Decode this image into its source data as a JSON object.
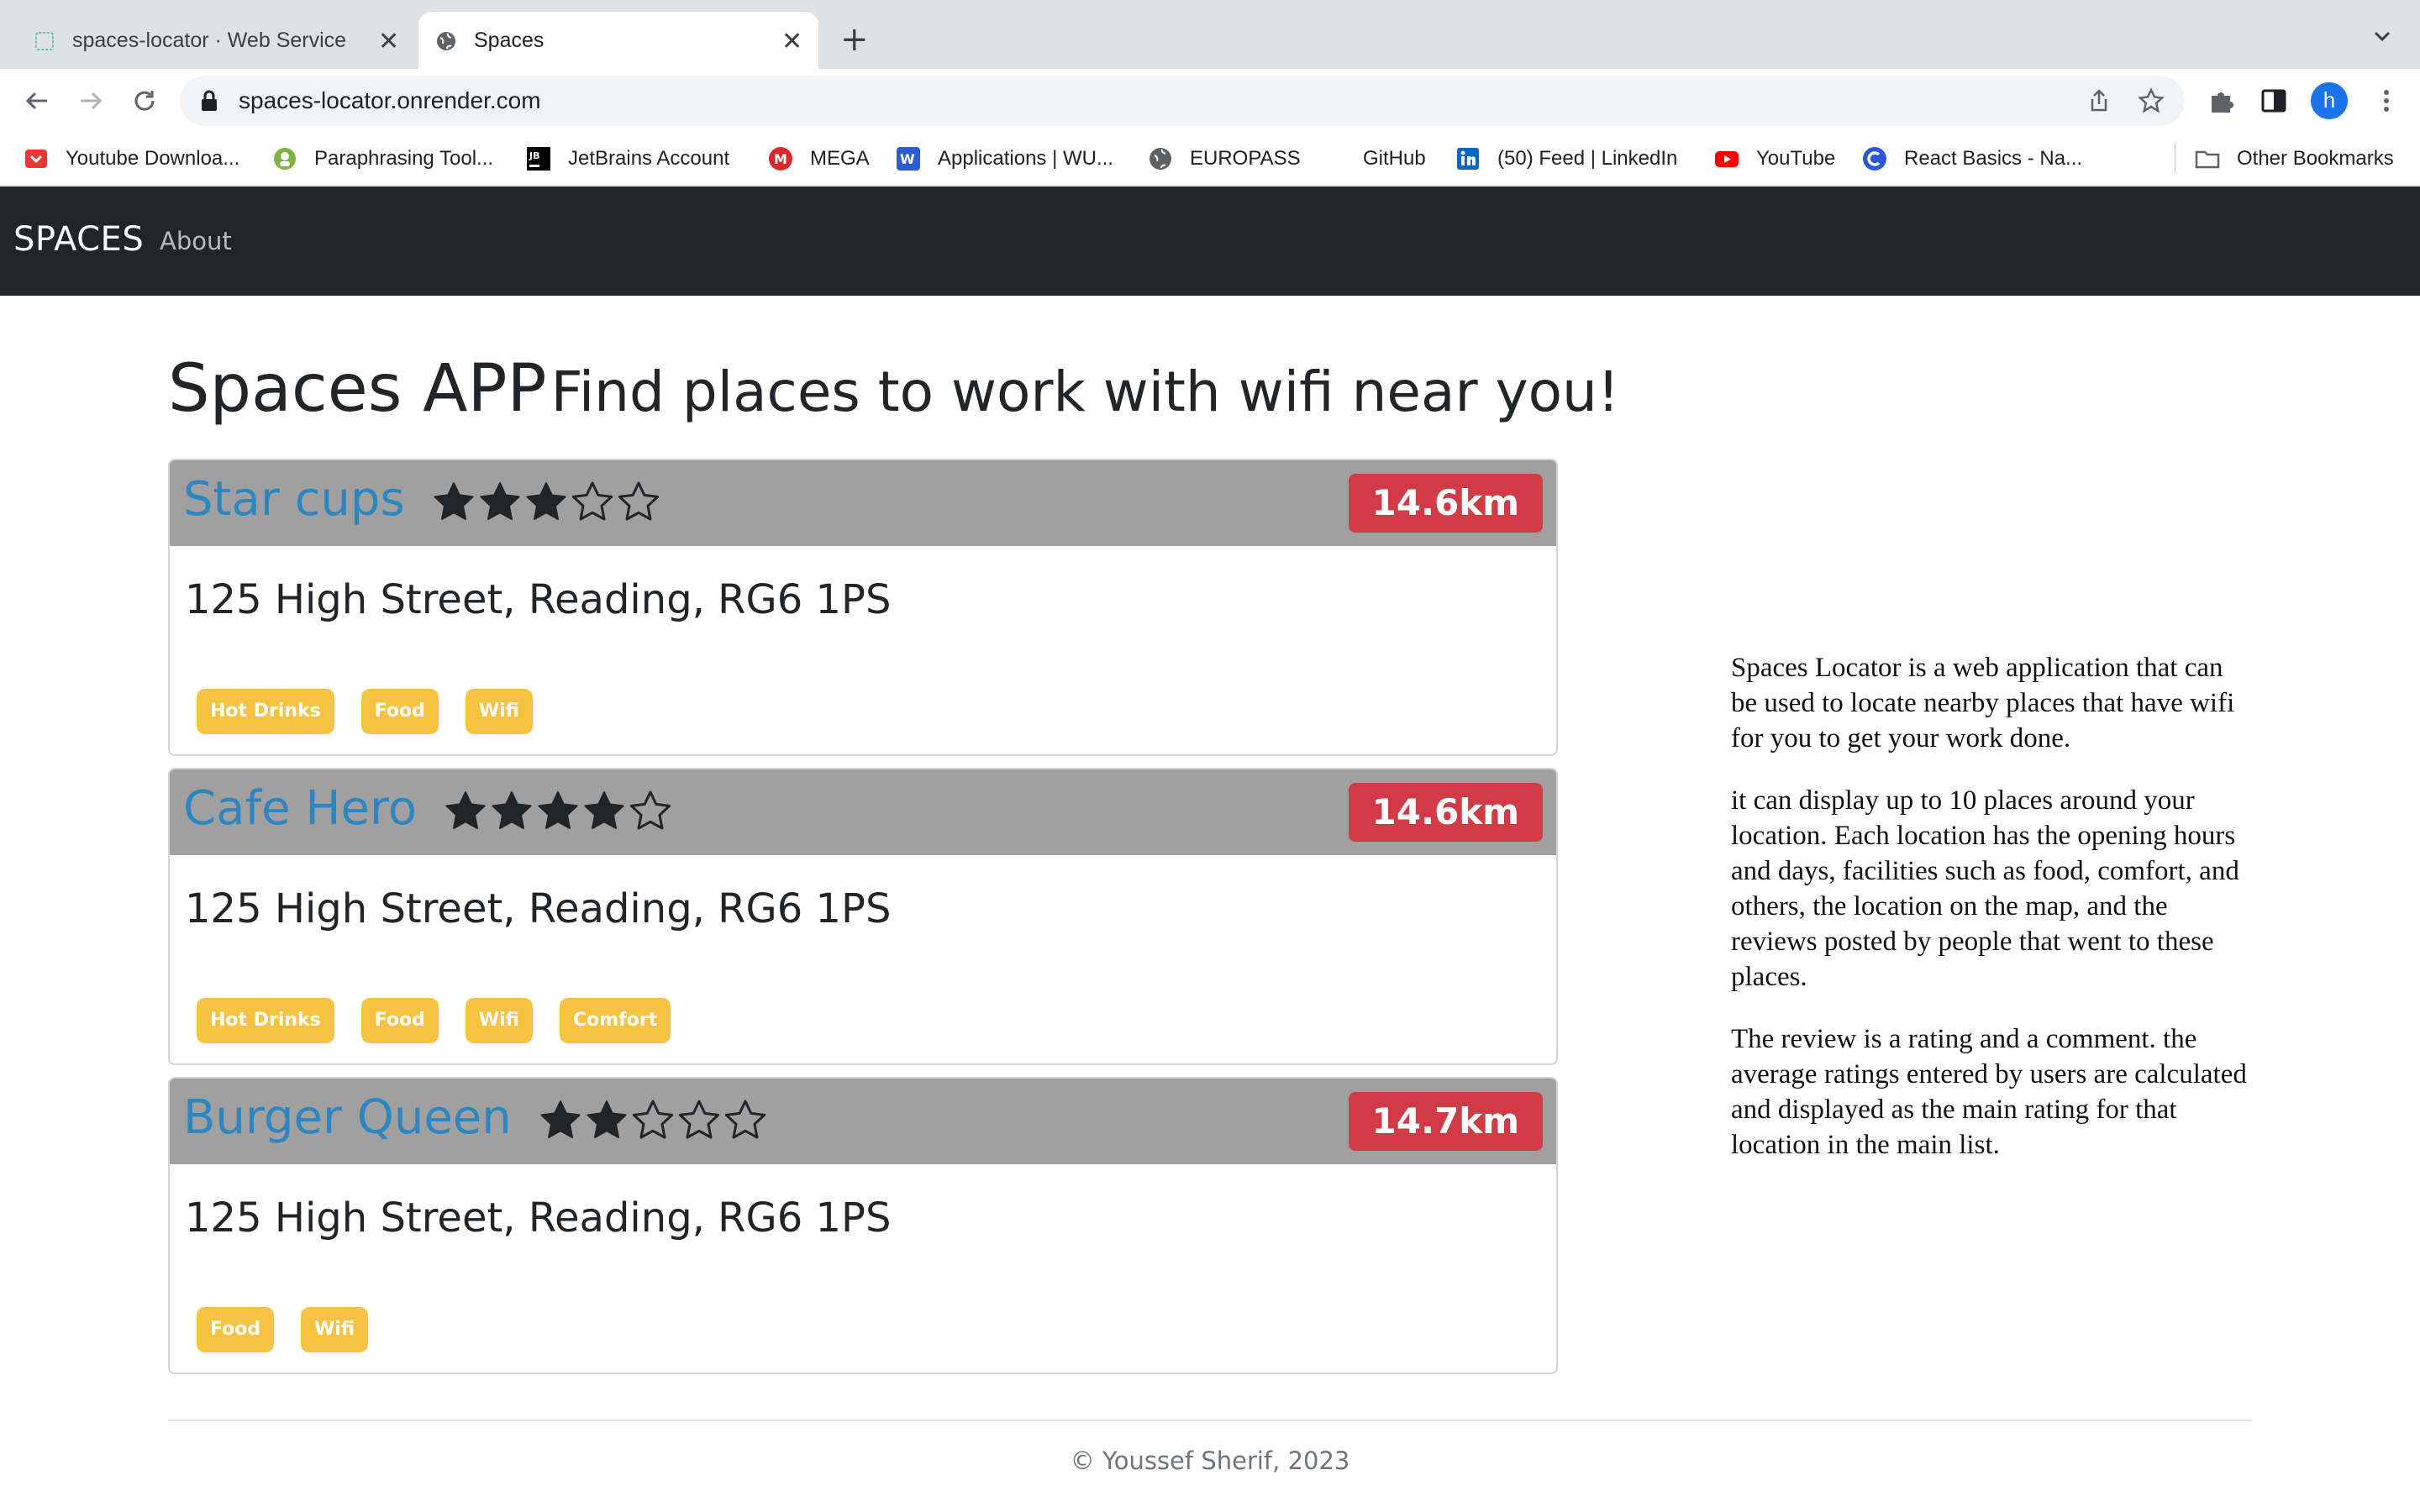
{
  "browser": {
    "tabs": [
      {
        "title": "spaces-locator · Web Service",
        "active": false
      },
      {
        "title": "Spaces",
        "active": true
      }
    ],
    "url": "spaces-locator.onrender.com",
    "profile_initial": "h",
    "bookmarks": [
      {
        "label": "Youtube Downloa...",
        "icon": "youtube-download-icon"
      },
      {
        "label": "Paraphrasing Tool...",
        "icon": "paraphrase-icon"
      },
      {
        "label": "JetBrains Account",
        "icon": "jetbrains-icon"
      },
      {
        "label": "MEGA",
        "icon": "mega-icon"
      },
      {
        "label": "Applications | WU...",
        "icon": "wu-icon"
      },
      {
        "label": "EUROPASS",
        "icon": "globe-icon"
      },
      {
        "label": "GitHub",
        "icon": "github-icon"
      },
      {
        "label": "(50) Feed | LinkedIn",
        "icon": "linkedin-icon"
      },
      {
        "label": "YouTube",
        "icon": "youtube-icon"
      },
      {
        "label": "React Basics - Na...",
        "icon": "coursera-icon"
      }
    ],
    "other_bookmarks": "Other Bookmarks"
  },
  "site": {
    "brand": "SPACES",
    "nav_about": "About",
    "heading_main": "Spaces APP",
    "heading_sub": "Find places to work with wifi near you!",
    "locations": [
      {
        "name": "Star cups",
        "rating": 3,
        "distance": "14.6km",
        "address": "125 High Street, Reading, RG6 1PS",
        "facilities": [
          "Hot Drinks",
          "Food",
          "Wifi"
        ]
      },
      {
        "name": "Cafe Hero",
        "rating": 4,
        "distance": "14.6km",
        "address": "125 High Street, Reading, RG6 1PS",
        "facilities": [
          "Hot Drinks",
          "Food",
          "Wifi",
          "Comfort"
        ]
      },
      {
        "name": "Burger Queen",
        "rating": 2,
        "distance": "14.7km",
        "address": "125 High Street, Reading, RG6 1PS",
        "facilities": [
          "Food",
          "Wifi"
        ]
      }
    ],
    "about_paragraphs": [
      "Spaces Locator is a web application that can be used to locate nearby places that have wifi for you to get your work done.",
      "it can display up to 10 places around your location. Each location has the opening hours and days, facilities such as food, comfort, and others, the location on the map, and the reviews posted by people that went to these places.",
      "The review is a rating and a comment. the average ratings entered by users are calculated and displayed as the main rating for that location in the main list."
    ],
    "footer": "© Youssef Sherif, 2023"
  },
  "colors": {
    "navbar": "#212529",
    "card_header": "#a0a0a0",
    "location_name": "#2e86c1",
    "distance_badge": "#d13b45",
    "facility_badge": "#f5c242"
  }
}
